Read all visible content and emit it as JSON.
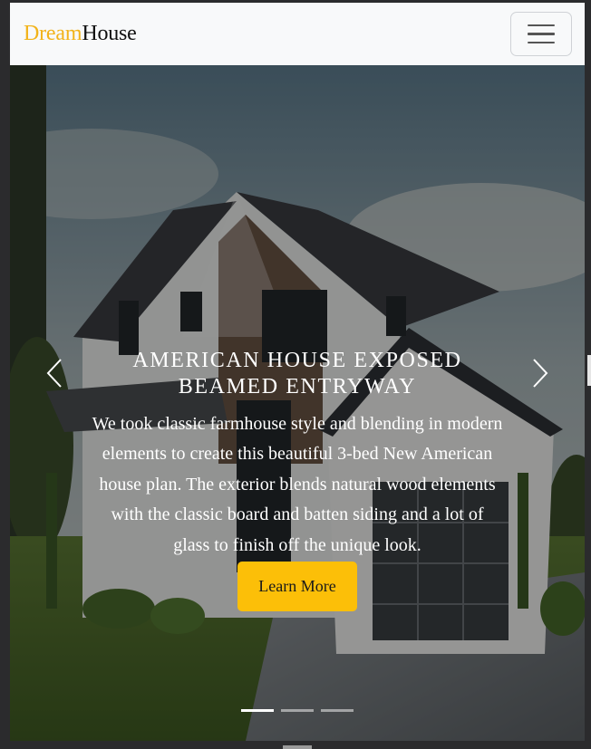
{
  "navbar": {
    "brand_part1": "Dream",
    "brand_part2": "House",
    "toggler_icon": "hamburger-menu-icon"
  },
  "carousel": {
    "active_slide": 1,
    "slide_count": 3,
    "slide": {
      "title": "AMERICAN HOUSE EXPOSED BEAMED ENTRYWAY",
      "text": "We took classic farmhouse style and blending in modern elements to create this beautiful 3-bed New American house plan. The exterior blends natural wood elements with the classic board and batten siding and a lot of glass to finish off the unique look.",
      "button_label": "Learn More"
    },
    "prev_icon": "chevron-left-icon",
    "next_icon": "chevron-right-icon"
  },
  "colors": {
    "brand_accent": "#f2b31a",
    "button_bg": "#fcbf08",
    "navbar_bg": "#f8f9fa"
  }
}
